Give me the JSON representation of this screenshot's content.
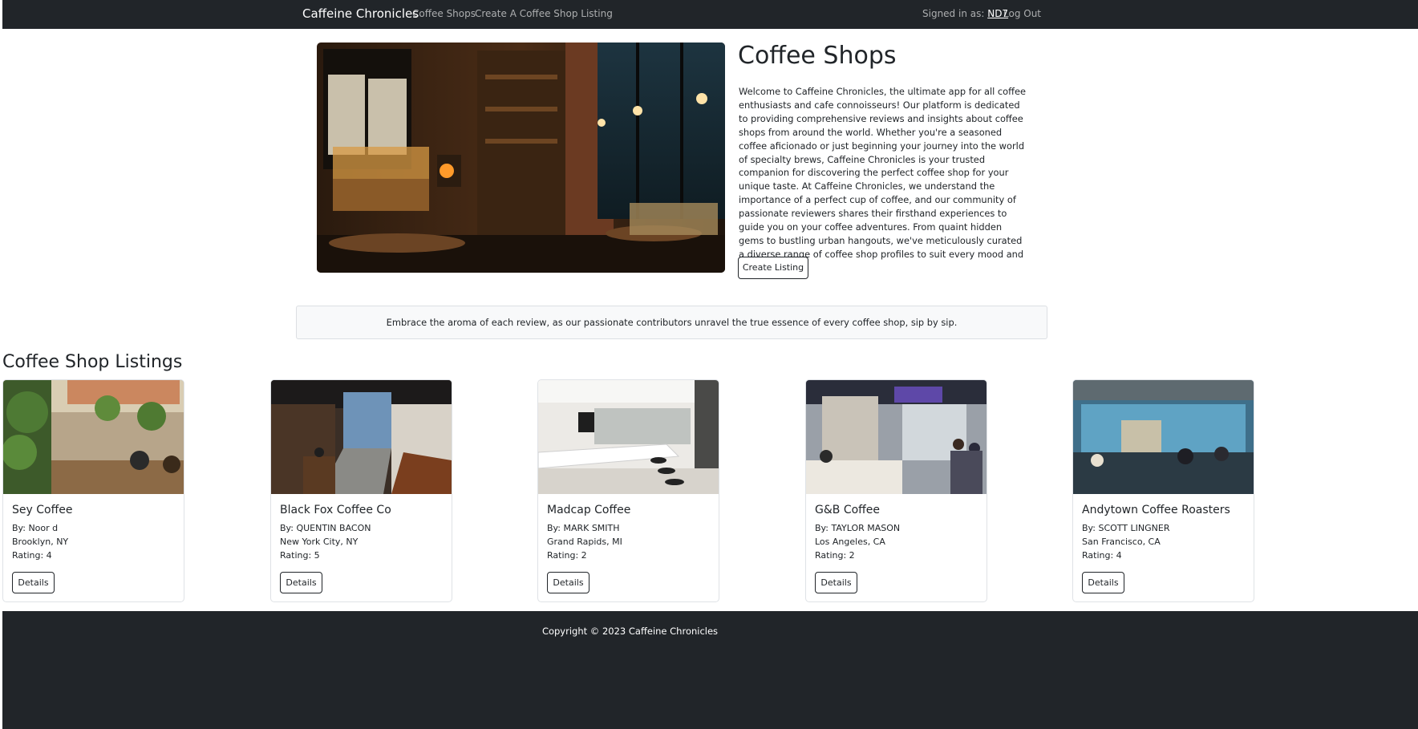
{
  "navbar": {
    "brand": "Caffeine Chronicles",
    "links": [
      "Coffee Shops",
      "Create A Coffee Shop Listing"
    ],
    "signed_in_prefix": "Signed in as:",
    "username": "ND7",
    "logout": "Log Out"
  },
  "hero": {
    "title": "Coffee Shops",
    "description": "Welcome to Caffeine Chronicles, the ultimate app for all coffee enthusiasts and cafe connoisseurs! Our platform is dedicated to providing comprehensive reviews and insights about coffee shops from around the world. Whether you're a seasoned coffee aficionado or just beginning your journey into the world of specialty brews, Caffeine Chronicles is your trusted companion for discovering the perfect coffee shop for your unique taste. At Caffeine Chronicles, we understand the importance of a perfect cup of coffee, and our community of passionate reviewers shares their firsthand experiences to guide you on your coffee adventures. From quaint hidden gems to bustling urban hangouts, we've meticulously curated a diverse range of coffee shop profiles to suit every mood and preference.",
    "button": "Create Listing"
  },
  "banner": "Embrace the aroma of each review, as our passionate contributors unravel the true essence of every coffee shop, sip by sip.",
  "listings": {
    "title": "Coffee Shop Listings",
    "cards": [
      {
        "name": "Sey Coffee",
        "by": "By: Noor d",
        "location": "Brooklyn, NY",
        "rating": "Rating: 4",
        "button": "Details"
      },
      {
        "name": "Black Fox Coffee Co",
        "by": "By: QUENTIN BACON",
        "location": "New York City, NY",
        "rating": "Rating: 5",
        "button": "Details"
      },
      {
        "name": "Madcap Coffee",
        "by": "By: MARK SMITH",
        "location": "Grand Rapids, MI",
        "rating": "Rating: 2",
        "button": "Details"
      },
      {
        "name": "G&B Coffee",
        "by": "By: TAYLOR MASON",
        "location": "Los Angeles, CA",
        "rating": "Rating: 2",
        "button": "Details"
      },
      {
        "name": "Andytown Coffee Roasters",
        "by": "By: SCOTT LINGNER",
        "location": "San Francisco, CA",
        "rating": "Rating: 4",
        "button": "Details"
      }
    ]
  },
  "footer": "Copyright © 2023 Caffeine Chronicles",
  "colors": {
    "navbar": "#212529",
    "text": "#212529",
    "banner_bg": "#f8f9fa"
  }
}
